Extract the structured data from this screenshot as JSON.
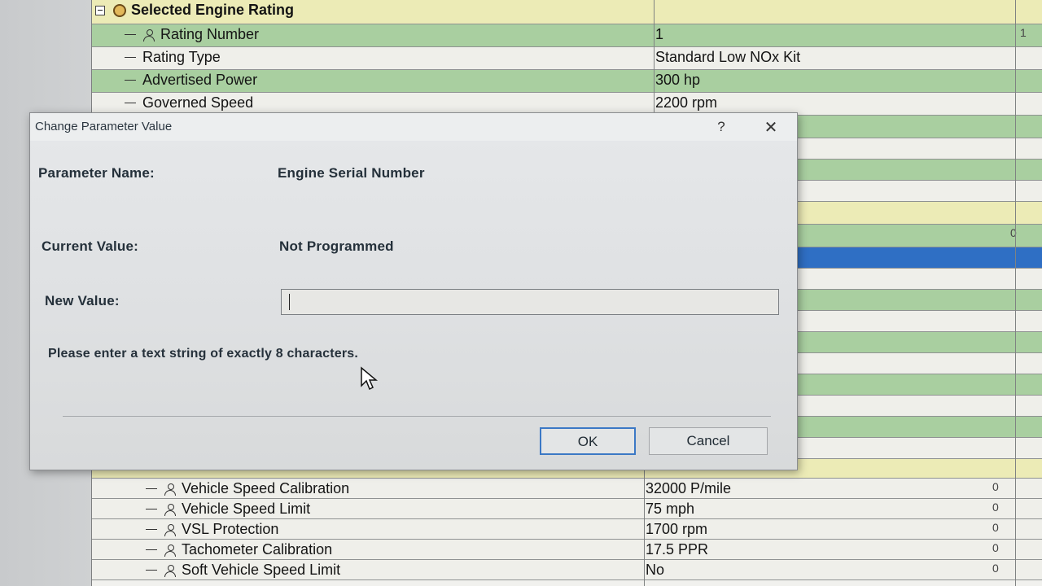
{
  "background_rows_top": [
    {
      "name": "Selected Engine Rating",
      "value": "",
      "style": "yellow",
      "icon": "badge-icon",
      "collapse": true
    },
    {
      "name": "Rating Number",
      "value": "1",
      "style": "green",
      "icon": "person-icon",
      "extra": "1"
    },
    {
      "name": "Rating Type",
      "value": "Standard Low NOx Kit",
      "style": "light",
      "icon": ""
    },
    {
      "name": "Advertised Power",
      "value": "300 hp",
      "style": "green",
      "icon": ""
    },
    {
      "name": "Governed Speed",
      "value": "2200 rpm",
      "style": "light",
      "icon": ""
    }
  ],
  "background_side_extra": "0",
  "background_rows_bottom": [
    {
      "name": "Vehicle Speed Calibration",
      "value": "32000 P/mile",
      "extra": "0"
    },
    {
      "name": "Vehicle Speed Limit",
      "value": "75 mph",
      "extra": "0"
    },
    {
      "name": "VSL Protection",
      "value": "1700 rpm",
      "extra": "0"
    },
    {
      "name": "Tachometer Calibration",
      "value": "17.5 PPR",
      "extra": "0"
    },
    {
      "name": "Soft Vehicle Speed Limit",
      "value": "No",
      "extra": "0"
    }
  ],
  "dialog": {
    "title": "Change Parameter Value",
    "help_label": "?",
    "close_label": "✕",
    "parameter_name_label": "Parameter Name:",
    "parameter_name_value": "Engine Serial Number",
    "current_value_label": "Current Value:",
    "current_value": "Not Programmed",
    "new_value_label": "New Value:",
    "new_value": "",
    "hint": "Please enter a text string of exactly 8 characters.",
    "ok_label": "OK",
    "cancel_label": "Cancel"
  }
}
